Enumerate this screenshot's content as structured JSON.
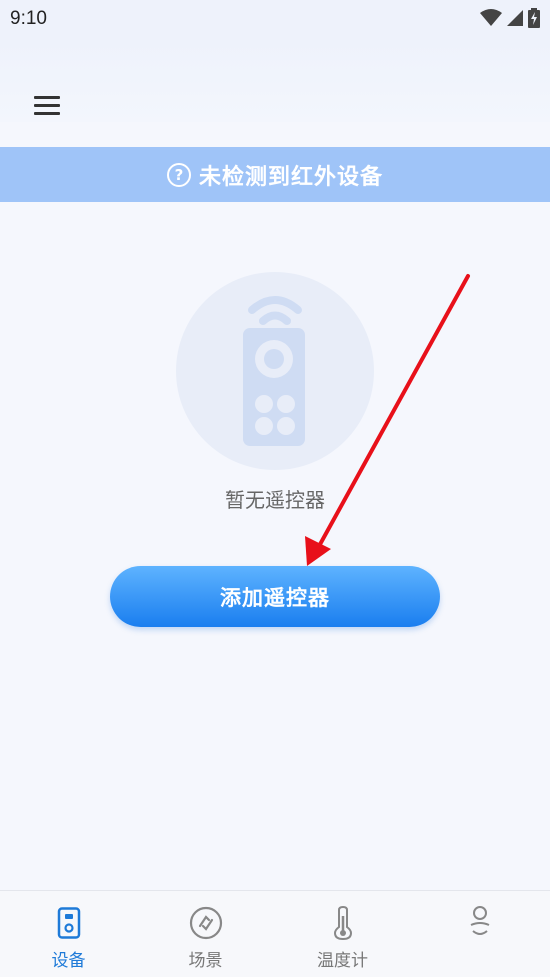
{
  "status_bar": {
    "time": "9:10",
    "icons": [
      "wifi-icon",
      "cell-signal-icon",
      "battery-charging-icon"
    ]
  },
  "app_bar": {
    "menu_icon": "hamburger-menu-icon"
  },
  "banner": {
    "icon": "help-circle-icon",
    "icon_glyph": "?",
    "text": "未检测到红外设备",
    "color": "#9fc4f8"
  },
  "empty_state": {
    "icon": "remote-control-icon",
    "text": "暂无遥控器"
  },
  "primary_action": {
    "label": "添加遥控器",
    "color": "#1a7eef"
  },
  "annotation": {
    "type": "red-arrow",
    "color": "#e8101a"
  },
  "bottom_nav": {
    "active_color": "#1e7ad8",
    "items": [
      {
        "label": "设备",
        "icon": "device-icon",
        "active": true
      },
      {
        "label": "场景",
        "icon": "scene-icon",
        "active": false
      },
      {
        "label": "温度计",
        "icon": "thermometer-icon",
        "active": false
      },
      {
        "label": "",
        "icon": "profile-icon",
        "active": false
      }
    ]
  }
}
